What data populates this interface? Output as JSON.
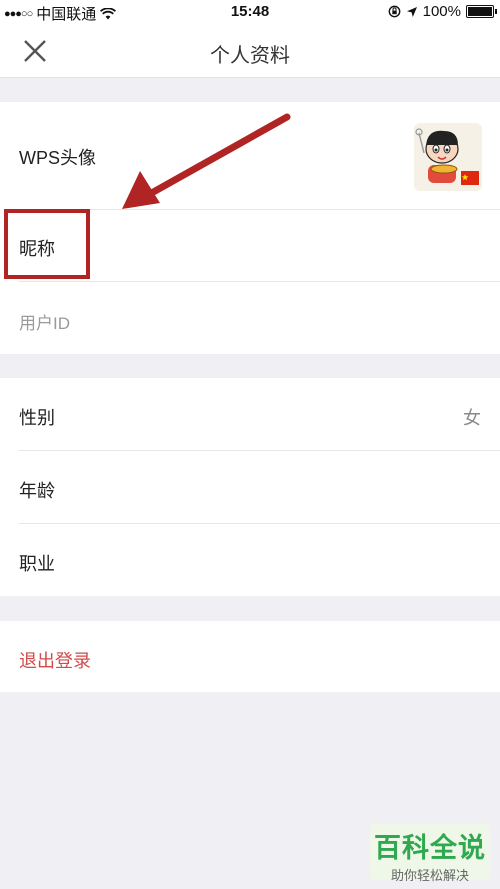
{
  "status_bar": {
    "signal": "●●●○○",
    "carrier": "中国联通",
    "wifi_icon": "wifi-icon",
    "time": "15:48",
    "battery": "100%"
  },
  "nav": {
    "title": "个人资料",
    "close_icon": "close-icon"
  },
  "profile_group": {
    "avatar_label": "WPS头像",
    "nickname_label": "昵称",
    "userid_label": "用户ID"
  },
  "info_group": {
    "gender_label": "性别",
    "gender_value": "女",
    "age_label": "年龄",
    "job_label": "职业"
  },
  "logout": {
    "label": "退出登录"
  },
  "watermark": {
    "title": "百科全说",
    "subtitle": "助你轻松解决"
  },
  "colors": {
    "accent_red": "#b02424",
    "logout_red": "#d24a4a",
    "watermark_green": "#2fa84f"
  }
}
